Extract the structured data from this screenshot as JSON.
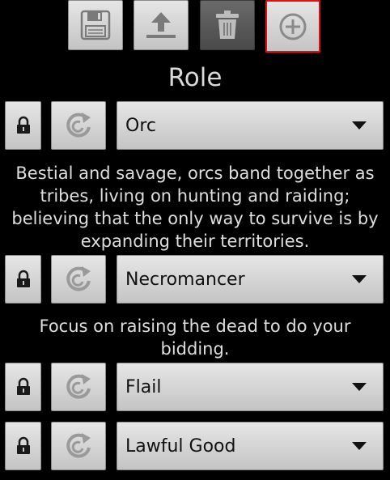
{
  "toolbar": {
    "save_icon": "floppy-disk-icon",
    "export_icon": "upload-icon",
    "delete_icon": "trash-icon",
    "add_icon": "plus-circle-icon"
  },
  "title": "Role",
  "rows": [
    {
      "value": "Orc",
      "description": "Bestial and savage, orcs band together as tribes, living on hunting and raiding; believing that the only way to survive is by expanding their territories."
    },
    {
      "value": "Necromancer",
      "description": "Focus on raising the dead to do your bidding."
    },
    {
      "value": "Flail"
    },
    {
      "value": "Lawful Good"
    }
  ],
  "colors": {
    "background": "#000000",
    "selected_outline": "#e01010"
  }
}
